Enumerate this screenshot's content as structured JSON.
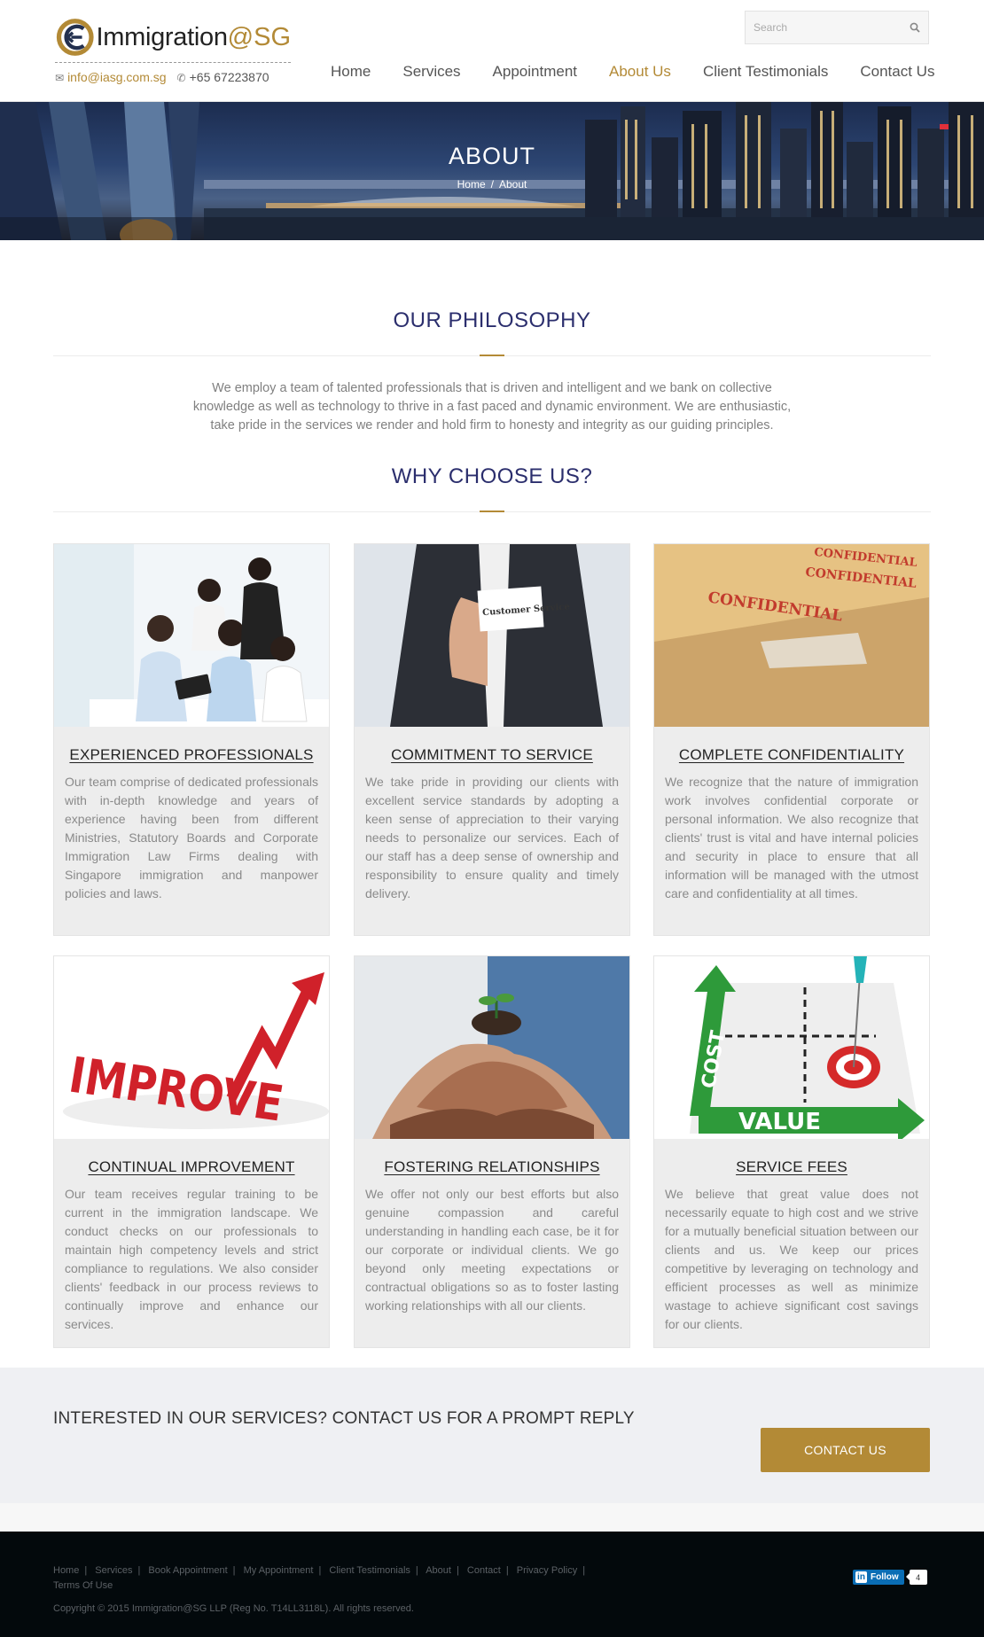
{
  "header": {
    "logo_text": "Immigration",
    "logo_accent": "@SG",
    "email": "info@iasg.com.sg",
    "phone": "+65 67223870",
    "search_placeholder": "Search"
  },
  "nav": {
    "items": [
      "Home",
      "Services",
      "Appointment",
      "About Us",
      "Client Testimonials",
      "Contact Us"
    ],
    "active": "About Us"
  },
  "hero": {
    "title": "ABOUT",
    "breadcrumb_home": "Home",
    "breadcrumb_sep": "/",
    "breadcrumb_current": "About"
  },
  "philosophy": {
    "title": "OUR PHILOSOPHY",
    "text": "We employ a team of talented professionals that is driven and intelligent and we bank on collective knowledge as well as technology to thrive in a fast paced and dynamic environment. We are enthusiastic, take pride in the services we render and hold firm to honesty and integrity as our guiding principles."
  },
  "why": {
    "title": "WHY CHOOSE US?",
    "cards": [
      {
        "title": "EXPERIENCED PROFESSIONALS",
        "text": "Our team comprise of dedicated professionals with in-depth knowledge and years of experience having been from different Ministries, Statutory Boards and Corporate Immigration Law Firms dealing with Singapore immigration and manpower policies and laws."
      },
      {
        "title": "COMMITMENT TO SERVICE",
        "text": "We take pride in providing our clients with excellent service standards by adopting a keen sense of appreciation to their varying needs to personalize our services. Each of our staff has a deep sense of ownership and responsibility to ensure quality and timely delivery.",
        "image_text": "Customer Service"
      },
      {
        "title": "COMPLETE CONFIDENTIALITY",
        "text": "We recognize that the nature of immigration work involves confidential corporate or personal information. We also recognize that clients' trust is vital and have internal policies and security in place to ensure that all information will be managed with the utmost care and confidentiality at all times.",
        "image_text": "CONFIDENTIAL"
      },
      {
        "title": "CONTINUAL IMPROVEMENT",
        "text": "Our team receives regular training to be current in the immigration landscape. We conduct checks on our professionals to maintain high competency levels and strict compliance to regulations. We also consider clients' feedback in our process reviews to continually improve and enhance our services.",
        "image_text": "IMPROVE"
      },
      {
        "title": "FOSTERING RELATIONSHIPS",
        "text": "We offer not only our best efforts but also genuine compassion and careful understanding in handling each case, be it for our corporate or individual clients. We go beyond only meeting expectations or contractual obligations so as to foster lasting working relationships with all our clients."
      },
      {
        "title": "SERVICE FEES",
        "text": "We believe that great value does not necessarily equate to high cost and we strive for a mutually beneficial situation between our clients and us. We keep our prices competitive by leveraging on technology and efficient processes as well as minimize wastage to achieve significant cost savings for our clients.",
        "image_text_cost": "COST",
        "image_text_value": "VALUE"
      }
    ]
  },
  "cta": {
    "text": "INTERESTED IN OUR SERVICES? CONTACT US FOR A PROMPT REPLY",
    "button": "CONTACT US"
  },
  "footer": {
    "links": [
      "Home",
      "Services",
      "Book Appointment",
      "My Appointment",
      "Client Testimonials",
      "About",
      "Contact",
      "Privacy Policy",
      "Terms Of Use"
    ],
    "copyright": "Copyright © 2015 Immigration@SG LLP (Reg No. T14LL3118L). All rights reserved.",
    "linkedin_label": "Follow",
    "linkedin_count": "4"
  },
  "colors": {
    "accent": "#b38a36",
    "heading": "#2b2e6d",
    "footer_bg": "#03090c",
    "cta_bg": "#eff0f3"
  }
}
